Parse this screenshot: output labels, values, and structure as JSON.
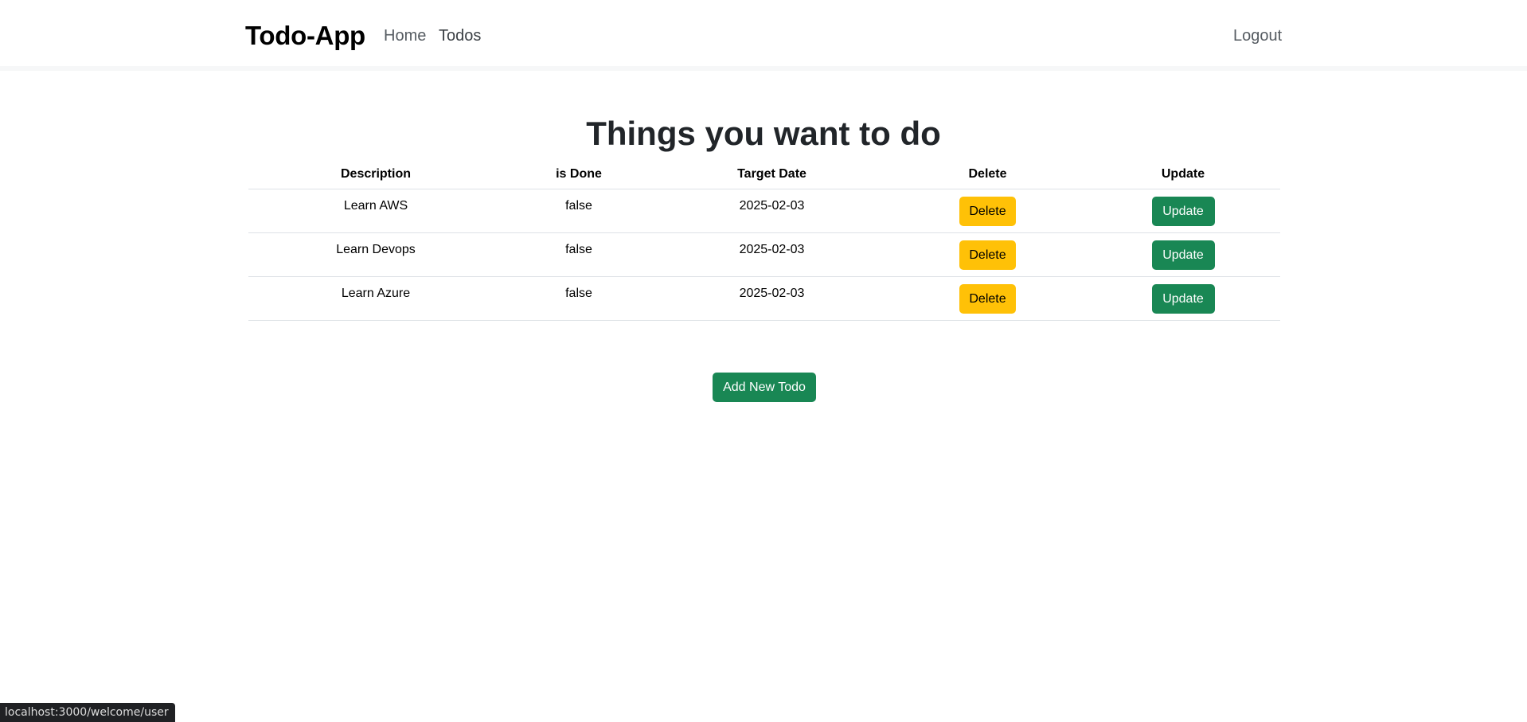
{
  "navbar": {
    "brand": "Todo-App",
    "links": [
      {
        "label": "Home"
      },
      {
        "label": "Todos"
      }
    ],
    "logout_label": "Logout"
  },
  "main": {
    "title": "Things you want to do",
    "table": {
      "headers": [
        "Description",
        "is Done",
        "Target Date",
        "Delete",
        "Update"
      ],
      "rows": [
        {
          "description": "Learn AWS",
          "done": "false",
          "target_date": "2025-02-03",
          "delete_label": "Delete",
          "update_label": "Update"
        },
        {
          "description": "Learn Devops",
          "done": "false",
          "target_date": "2025-02-03",
          "delete_label": "Delete",
          "update_label": "Update"
        },
        {
          "description": "Learn Azure",
          "done": "false",
          "target_date": "2025-02-03",
          "delete_label": "Delete",
          "update_label": "Update"
        }
      ]
    },
    "add_button_label": "Add New Todo"
  },
  "status_bar": {
    "url": "localhost:3000/welcome/user"
  },
  "colors": {
    "warning": "#ffc107",
    "success": "#198754",
    "text": "#212529"
  }
}
